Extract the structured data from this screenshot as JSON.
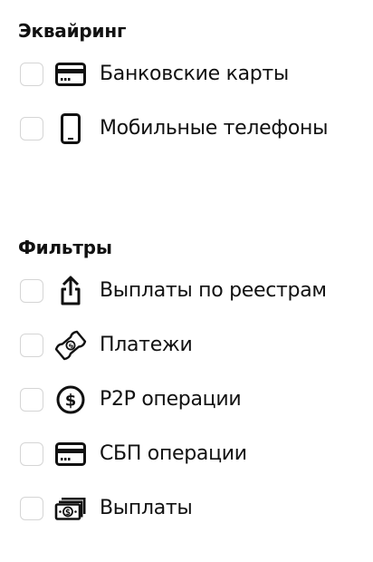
{
  "acquiring": {
    "title": "Эквайринг",
    "items": [
      {
        "label": "Банковские карты",
        "icon": "credit-card-icon",
        "checked": false
      },
      {
        "label": "Мобильные телефоны",
        "icon": "mobile-phone-icon",
        "checked": false
      }
    ]
  },
  "filters": {
    "title": "Фильтры",
    "items": [
      {
        "label": "Выплаты по реестрам",
        "icon": "upload-share-icon",
        "checked": false
      },
      {
        "label": "Платежи",
        "icon": "banknote-icon",
        "checked": false
      },
      {
        "label": "P2P операции",
        "icon": "dollar-circle-icon",
        "checked": false
      },
      {
        "label": "СБП операции",
        "icon": "credit-card-icon",
        "checked": false
      },
      {
        "label": "Выплаты",
        "icon": "cash-stack-icon",
        "checked": false
      }
    ]
  }
}
